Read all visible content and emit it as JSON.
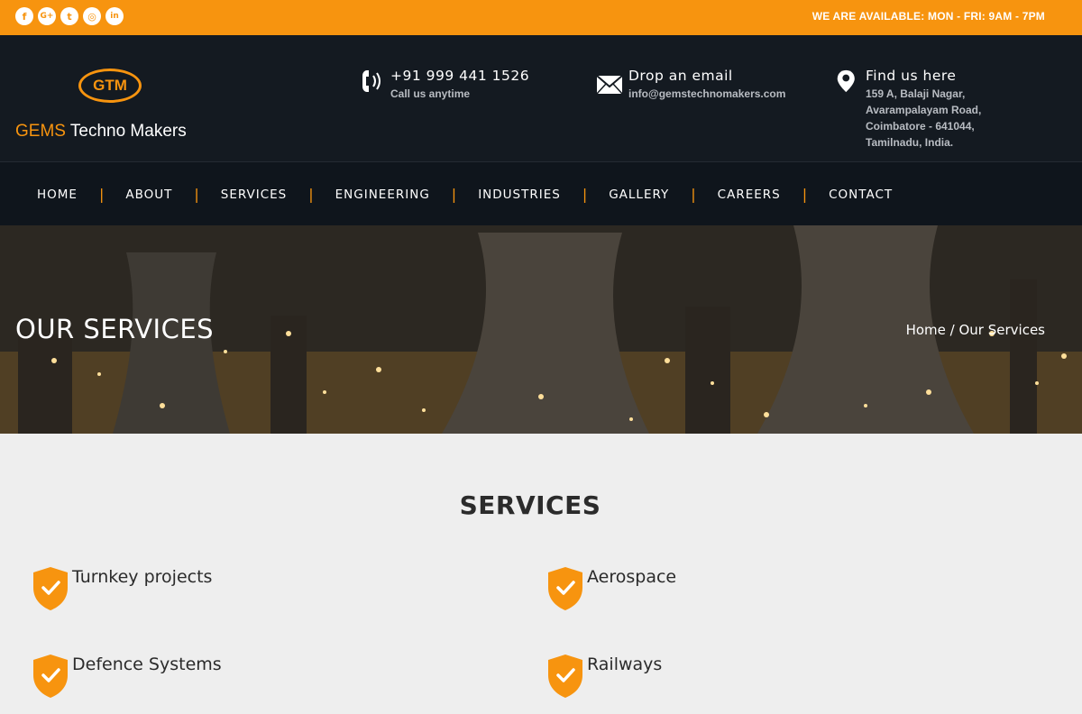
{
  "topbar": {
    "social": [
      {
        "icon": "facebook-icon",
        "glyph": "f"
      },
      {
        "icon": "google-plus-icon",
        "glyph": "G+"
      },
      {
        "icon": "twitter-icon",
        "glyph": "t"
      },
      {
        "icon": "instagram-icon",
        "glyph": "◎"
      },
      {
        "icon": "linkedin-icon",
        "glyph": "in"
      }
    ],
    "availability": "WE ARE AVAILABLE: MON - FRI: 9AM - 7PM"
  },
  "header": {
    "logo_text": "GTM",
    "brand_accent": "GEMS",
    "brand_rest": " Techno Makers",
    "phone": {
      "icon": "phone-icon",
      "title": "+91 999 441 1526",
      "subtitle": "Call us anytime"
    },
    "email": {
      "icon": "envelope-icon",
      "title": "Drop an email",
      "subtitle": "info@gemstechnomakers.com"
    },
    "location": {
      "icon": "map-pin-icon",
      "title": "Find us here",
      "address_lines": [
        "159 A, Balaji Nagar,",
        "Avarampalayam Road,",
        "Coimbatore - 641044,",
        "Tamilnadu, India."
      ]
    }
  },
  "nav": {
    "items": [
      "HOME",
      "ABOUT",
      "SERVICES",
      "ENGINEERING",
      "INDUSTRIES",
      "GALLERY",
      "CAREERS",
      "CONTACT"
    ],
    "separator": "|"
  },
  "hero": {
    "title": "OUR SERVICES",
    "breadcrumb_home": "Home",
    "breadcrumb_sep": " / ",
    "breadcrumb_current": "Our Services"
  },
  "services": {
    "heading": "SERVICES",
    "items": [
      "Turnkey projects",
      "Aerospace",
      "Defence Systems",
      "Railways"
    ],
    "icon": "shield-check-icon"
  },
  "colors": {
    "accent": "#f7940f",
    "header_bg": "#141a21",
    "nav_bg": "#0f151c",
    "page_bg": "#eeeeee"
  }
}
